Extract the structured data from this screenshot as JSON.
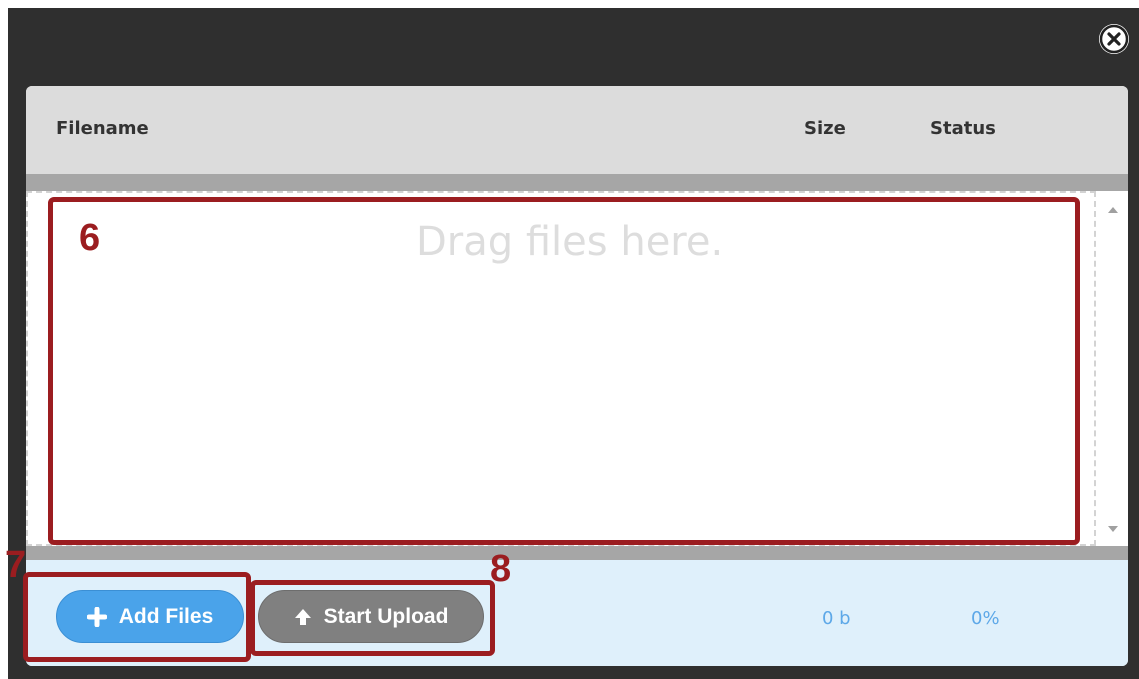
{
  "dialog": {
    "close_icon": "close-circle-icon"
  },
  "table": {
    "headers": {
      "filename": "Filename",
      "size": "Size",
      "status": "Status"
    },
    "drop_hint": "Drag files here."
  },
  "footer": {
    "add_files_label": "Add Files",
    "add_files_icon": "plus-icon",
    "start_upload_label": "Start Upload",
    "start_upload_icon": "arrow-up-icon",
    "total_size": "0 b",
    "total_status": "0%"
  },
  "annotations": {
    "drop_area": "6",
    "add_files": "7",
    "start_upload": "8"
  },
  "colors": {
    "annotation": "#9b1d20",
    "add_button": "#4aa3ea",
    "upload_button": "#808080",
    "footer_text": "#5da8e8"
  }
}
